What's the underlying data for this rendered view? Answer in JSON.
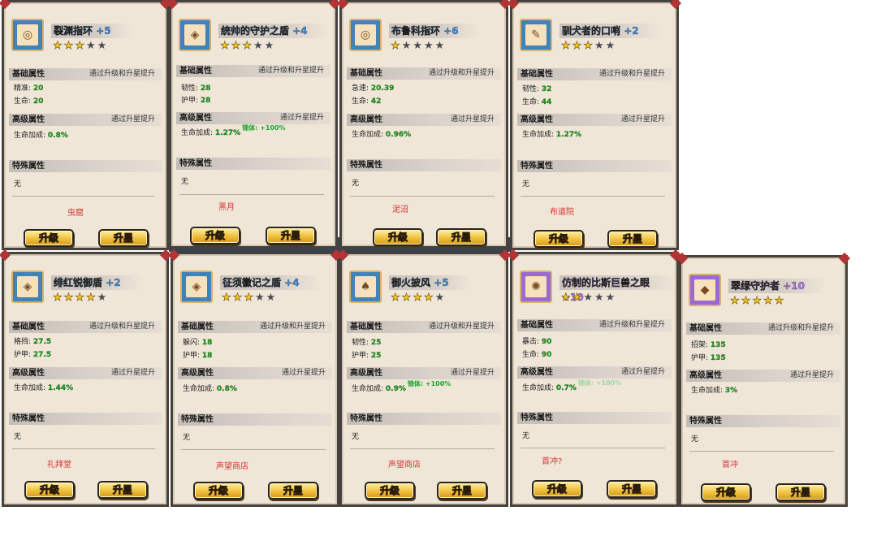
{
  "labels": {
    "basic": "基础属性",
    "advanced": "高级属性",
    "special": "特殊属性",
    "note_both": "通过升级和升星提升",
    "note_star": "通过升星提升",
    "hp_bonus": "生命加成:",
    "bonus_prefix": "锦体:",
    "none": "无",
    "upgrade": "升级",
    "star_up": "升星"
  },
  "colors": {
    "title_blue": "#3f8fe0",
    "title_purple": "#b070ea",
    "source_red": "#d43434",
    "stat_green": "#1b9b1b"
  },
  "cards": [
    {
      "name": "裂渊指环",
      "level": "+5",
      "quality": "blue",
      "icon": "ring-icon",
      "stars": 3,
      "stats": [
        {
          "label": "精准:",
          "value": "20"
        },
        {
          "label": "生命:",
          "value": "20"
        }
      ],
      "hp_bonus": "0.8%",
      "extra_bonus": "",
      "source": "虫窟"
    },
    {
      "name": "统帅的守护之盾",
      "level": "+4",
      "quality": "blue",
      "icon": "shield-icon",
      "stars": 3,
      "stats": [
        {
          "label": "韧性:",
          "value": "28"
        },
        {
          "label": "护甲:",
          "value": "28"
        }
      ],
      "hp_bonus": "1.27%",
      "extra_bonus": "+100%",
      "source": "黑月"
    },
    {
      "name": "布鲁科指环",
      "level": "+6",
      "quality": "blue",
      "icon": "ring-icon",
      "stars": 1,
      "stats": [
        {
          "label": "急速:",
          "value": "20.39"
        },
        {
          "label": "生命:",
          "value": "42"
        }
      ],
      "hp_bonus": "0.96%",
      "extra_bonus": "",
      "source": "泥沼"
    },
    {
      "name": "驯犬者的口哨",
      "level": "+2",
      "quality": "blue",
      "icon": "whistle-icon",
      "stars": 3,
      "stats": [
        {
          "label": "韧性:",
          "value": "32"
        },
        {
          "label": "生命:",
          "value": "44"
        }
      ],
      "hp_bonus": "1.27%",
      "extra_bonus": "",
      "source": "布道院"
    },
    {
      "name": "绯红锐御盾",
      "level": "+2",
      "quality": "blue",
      "icon": "shield-icon",
      "stars": 4,
      "stats": [
        {
          "label": "格挡:",
          "value": "27.5"
        },
        {
          "label": "护甲:",
          "value": "27.5"
        }
      ],
      "hp_bonus": "1.44%",
      "extra_bonus": "",
      "source": "礼拜堂"
    },
    {
      "name": "征须徽记之盾",
      "level": "+4",
      "quality": "blue",
      "icon": "shield-icon",
      "stars": 3,
      "stats": [
        {
          "label": "躲闪:",
          "value": "18"
        },
        {
          "label": "护甲:",
          "value": "18"
        }
      ],
      "hp_bonus": "0.8%",
      "extra_bonus": "",
      "source": "声望商店"
    },
    {
      "name": "御火披风",
      "level": "+5",
      "quality": "blue",
      "icon": "cloak-icon",
      "stars": 4,
      "stats": [
        {
          "label": "韧性:",
          "value": "25"
        },
        {
          "label": "护甲:",
          "value": "25"
        }
      ],
      "hp_bonus": "0.9%",
      "extra_bonus": "+100%",
      "source": "声望商店"
    },
    {
      "name": "仿制的比斯巨兽之眼",
      "level": "+10",
      "quality": "purple",
      "icon": "eye-icon",
      "stars": 2,
      "stats": [
        {
          "label": "暴击:",
          "value": "90"
        },
        {
          "label": "生命:",
          "value": "90"
        }
      ],
      "hp_bonus": "0.7%",
      "extra_bonus": "+100%",
      "source": "首冲?"
    },
    {
      "name": "翠绿守护者",
      "level": "+10",
      "quality": "purple",
      "icon": "amulet-icon",
      "stars": 5,
      "stats": [
        {
          "label": "招架:",
          "value": "135"
        },
        {
          "label": "护甲:",
          "value": "135"
        }
      ],
      "hp_bonus": "3%",
      "extra_bonus": "",
      "source": "首冲"
    }
  ]
}
